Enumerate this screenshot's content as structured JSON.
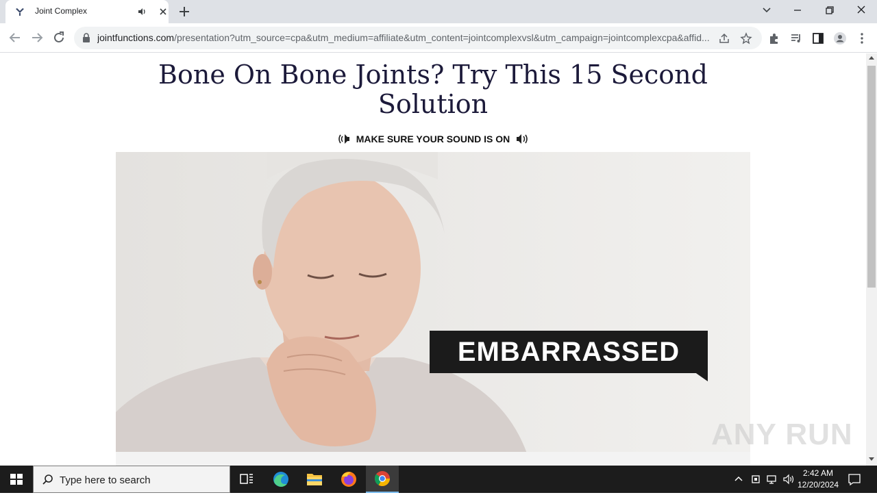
{
  "browser": {
    "tab": {
      "title": "Joint Complex"
    },
    "url": {
      "host": "jointfunctions.com",
      "path": "/presentation?utm_source=cpa&utm_medium=affiliate&utm_content=jointcomplexvsl&utm_campaign=jointcomplexcpa&affid..."
    }
  },
  "page": {
    "headline": "Bone On Bone Joints? Try This 15 Second Solution",
    "sound_notice": "MAKE SURE YOUR SOUND IS ON",
    "video": {
      "caption": "EMBARRASSED"
    },
    "watermark": "ANY RUN"
  },
  "taskbar": {
    "search_placeholder": "Type here to search",
    "time": "2:42 AM",
    "date": "12/20/2024"
  },
  "colors": {
    "headline": "#1c1a3a",
    "caption_bg": "#1b1b1b",
    "taskbar_bg": "#1c1c1c"
  }
}
